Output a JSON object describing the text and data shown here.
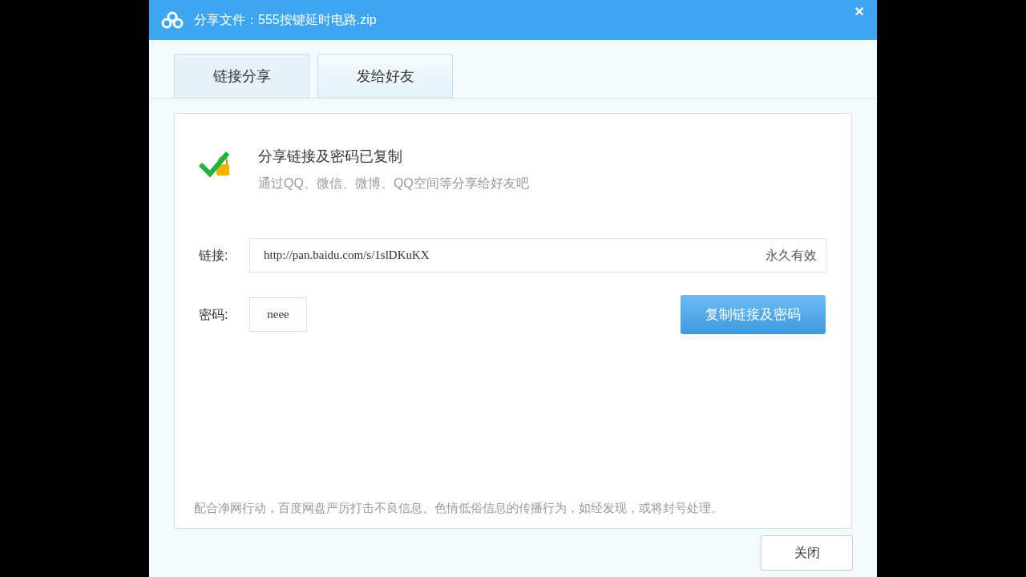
{
  "window": {
    "title": "分享文件：555按键延时电路.zip",
    "close": "×"
  },
  "tabs": [
    {
      "label": "链接分享",
      "selected": true
    },
    {
      "label": "发给好友",
      "selected": false
    }
  ],
  "status": {
    "title": "分享链接及密码已复制",
    "subtitle": "通过QQ、微信、微博、QQ空间等分享给好友吧"
  },
  "link": {
    "label": "链接:",
    "value": "http://pan.baidu.com/s/1slDKuKX",
    "validity": "永久有效"
  },
  "password": {
    "label": "密码:",
    "value": "neee"
  },
  "copy_button": "复制链接及密码",
  "notice": "配合净网行动，百度网盘严厉打击不良信息、色情低俗信息的传播行为，如经发现，或将封号处理。",
  "close_button": "关闭"
}
